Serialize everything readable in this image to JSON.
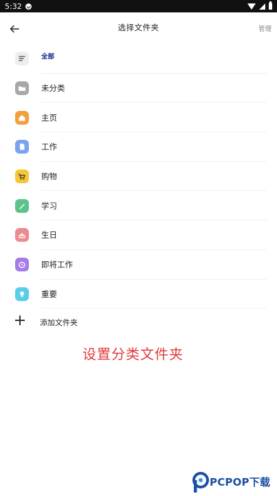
{
  "status_bar": {
    "time": "5:32"
  },
  "header": {
    "title": "选择文件夹",
    "manage": "管理"
  },
  "folders": [
    {
      "label": "全部",
      "icon": "list-icon",
      "color": "#eeeeee",
      "glyph": "#666666"
    },
    {
      "label": "未分类",
      "icon": "folder-icon",
      "color": "#a8a8a8",
      "glyph": "#ffffff"
    },
    {
      "label": "主页",
      "icon": "home-icon",
      "color": "#f2a03d",
      "glyph": "#ffffff"
    },
    {
      "label": "工作",
      "icon": "document-icon",
      "color": "#7aa3f0",
      "glyph": "#ffffff"
    },
    {
      "label": "购物",
      "icon": "cart-icon",
      "color": "#f5c637",
      "glyph": "#333333"
    },
    {
      "label": "学习",
      "icon": "pencil-icon",
      "color": "#5cc48a",
      "glyph": "#ffffff"
    },
    {
      "label": "生日",
      "icon": "cake-icon",
      "color": "#ec8a8f",
      "glyph": "#ffffff"
    },
    {
      "label": "即将工作",
      "icon": "clock-icon",
      "color": "#a67be8",
      "glyph": "#ffffff"
    },
    {
      "label": "重要",
      "icon": "bulb-icon",
      "color": "#59cde8",
      "glyph": "#ffffff"
    }
  ],
  "add_folder": {
    "label": "添加文件夹"
  },
  "caption": "设置分类文件夹",
  "watermark": {
    "brand": "PCPOP下载"
  }
}
